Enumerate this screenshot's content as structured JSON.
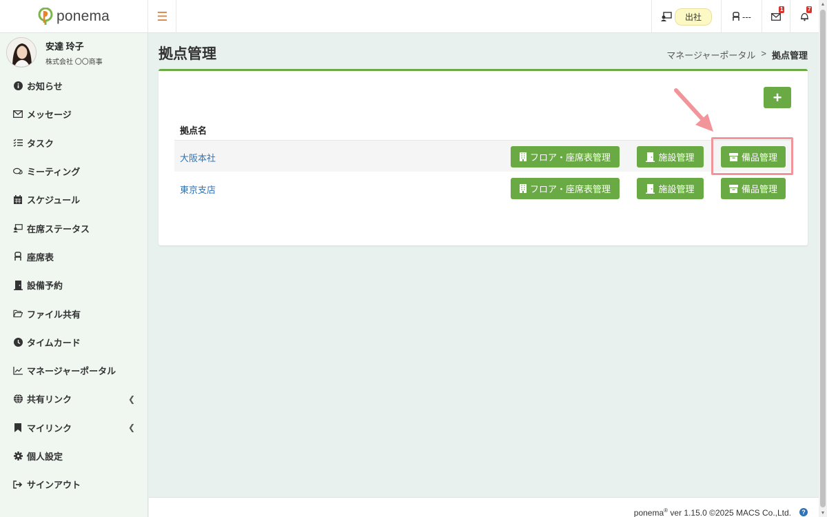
{
  "app": {
    "logo_text": "ponema"
  },
  "topbar": {
    "menu_icon": "hamburger-icon",
    "status_label": "出社",
    "seat_label": "---",
    "mail_count": "1",
    "bell_count": "7"
  },
  "user": {
    "name": "安達 玲子",
    "company": "株式会社 〇〇商事"
  },
  "sidebar": {
    "items": [
      {
        "label": "お知らせ",
        "icon": "info-icon"
      },
      {
        "label": "メッセージ",
        "icon": "envelope-icon"
      },
      {
        "label": "タスク",
        "icon": "checklist-icon"
      },
      {
        "label": "ミーティング",
        "icon": "chat-icon"
      },
      {
        "label": "スケジュール",
        "icon": "calendar-icon"
      },
      {
        "label": "在席ステータス",
        "icon": "presence-icon"
      },
      {
        "label": "座席表",
        "icon": "chair-icon"
      },
      {
        "label": "設備予約",
        "icon": "door-icon"
      },
      {
        "label": "ファイル共有",
        "icon": "folder-icon"
      },
      {
        "label": "タイムカード",
        "icon": "clock-icon"
      },
      {
        "label": "マネージャーポータル",
        "icon": "chart-icon"
      },
      {
        "label": "共有リンク",
        "icon": "globe-icon"
      },
      {
        "label": "マイリンク",
        "icon": "bookmark-icon"
      },
      {
        "label": "個人設定",
        "icon": "gear-icon"
      },
      {
        "label": "サインアウト",
        "icon": "signout-icon"
      }
    ]
  },
  "page": {
    "title": "拠点管理",
    "breadcrumb": {
      "parent": "マネージャーポータル",
      "separator": ">",
      "current": "拠点管理"
    }
  },
  "table": {
    "add_label": "+",
    "header": "拠点名",
    "rows": [
      {
        "name": "大阪本社",
        "floor_btn": "フロア・座席表管理",
        "facility_btn": "施設管理",
        "equipment_btn": "備品管理"
      },
      {
        "name": "東京支店",
        "floor_btn": "フロア・座席表管理",
        "facility_btn": "施設管理",
        "equipment_btn": "備品管理"
      }
    ]
  },
  "footer": {
    "brand": "ponema",
    "reg_mark": "®",
    "version": " ver 1.15.0 ©2025 MACS Co.,Ltd.",
    "help": "?"
  },
  "colors": {
    "accent_green": "#6aaa44",
    "link_blue": "#2f72b5",
    "highlight_pink": "#f2959a",
    "sidebar_bg": "#eff7f0",
    "content_bg": "#e8f1ee"
  }
}
